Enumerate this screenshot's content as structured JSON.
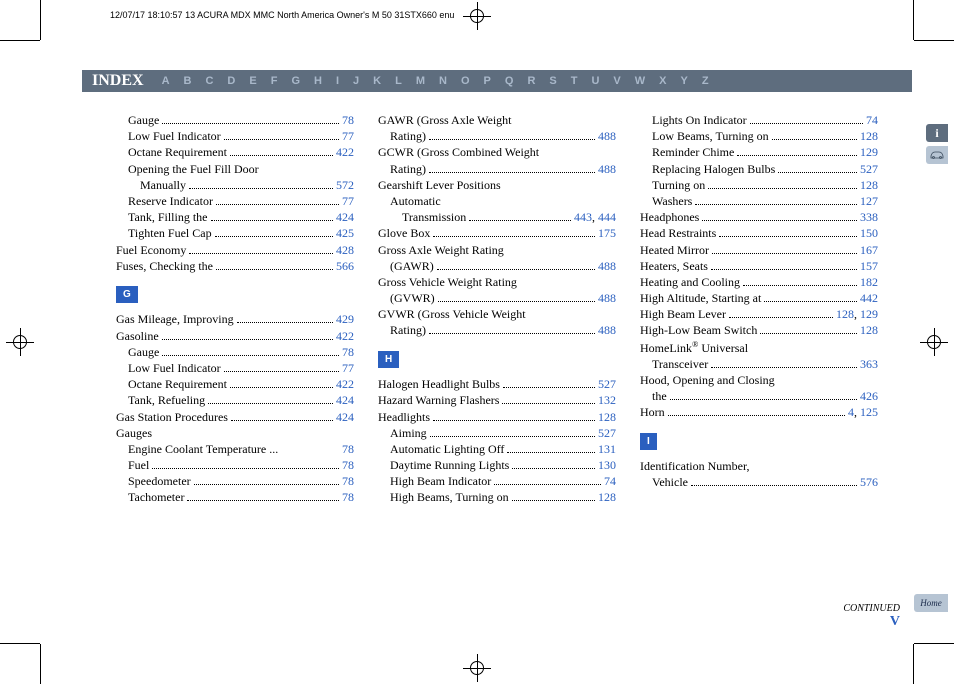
{
  "meta_header": "12/07/17 18:10:57   13 ACURA MDX MMC North America Owner's M 50 31STX660 enu",
  "index_title": "INDEX",
  "alphabet": [
    "A",
    "B",
    "C",
    "D",
    "E",
    "F",
    "G",
    "H",
    "I",
    "J",
    "K",
    "L",
    "M",
    "N",
    "O",
    "P",
    "Q",
    "R",
    "S",
    "T",
    "U",
    "V",
    "W",
    "X",
    "Y",
    "Z"
  ],
  "continued": "CONTINUED",
  "page_num": "V",
  "home": "Home",
  "col1": [
    {
      "t": "entry",
      "indent": 1,
      "label": "Gauge",
      "page": "78"
    },
    {
      "t": "entry",
      "indent": 1,
      "label": "Low Fuel Indicator",
      "page": "77"
    },
    {
      "t": "entry",
      "indent": 1,
      "label": "Octane Requirement",
      "page": "422"
    },
    {
      "t": "noref",
      "indent": 1,
      "label": "Opening the Fuel Fill Door"
    },
    {
      "t": "entry",
      "indent": 2,
      "label": "Manually",
      "page": "572"
    },
    {
      "t": "entry",
      "indent": 1,
      "label": "Reserve Indicator",
      "page": "77"
    },
    {
      "t": "entry",
      "indent": 1,
      "label": "Tank, Filling the",
      "page": "424"
    },
    {
      "t": "entry",
      "indent": 1,
      "label": "Tighten Fuel Cap",
      "page": "425"
    },
    {
      "t": "entry",
      "indent": 0,
      "label": "Fuel Economy",
      "page": "428"
    },
    {
      "t": "entry",
      "indent": 0,
      "label": "Fuses, Checking the",
      "page": "566"
    },
    {
      "t": "letter",
      "label": "G"
    },
    {
      "t": "entry",
      "indent": 0,
      "label": "Gas Mileage, Improving",
      "page": "429"
    },
    {
      "t": "entry",
      "indent": 0,
      "label": "Gasoline",
      "page": "422"
    },
    {
      "t": "entry",
      "indent": 1,
      "label": "Gauge",
      "page": "78"
    },
    {
      "t": "entry",
      "indent": 1,
      "label": "Low Fuel Indicator",
      "page": "77"
    },
    {
      "t": "entry",
      "indent": 1,
      "label": "Octane Requirement",
      "page": "422"
    },
    {
      "t": "entry",
      "indent": 1,
      "label": "Tank, Refueling",
      "page": "424"
    },
    {
      "t": "entry",
      "indent": 0,
      "label": "Gas Station Procedures",
      "page": "424"
    },
    {
      "t": "noref",
      "indent": 0,
      "label": "Gauges"
    },
    {
      "t": "entry",
      "indent": 1,
      "label": "Engine Coolant Temperature",
      "page": "78",
      "ellipsis": true
    },
    {
      "t": "entry",
      "indent": 1,
      "label": "Fuel",
      "page": "78"
    },
    {
      "t": "entry",
      "indent": 1,
      "label": "Speedometer",
      "page": "78"
    },
    {
      "t": "entry",
      "indent": 1,
      "label": "Tachometer",
      "page": "78"
    }
  ],
  "col2": [
    {
      "t": "noref",
      "indent": 0,
      "label": "GAWR (Gross Axle Weight"
    },
    {
      "t": "entry",
      "indent": 1,
      "label": "Rating)",
      "page": "488"
    },
    {
      "t": "noref",
      "indent": 0,
      "label": "GCWR (Gross Combined Weight"
    },
    {
      "t": "entry",
      "indent": 1,
      "label": "Rating)",
      "page": "488"
    },
    {
      "t": "noref",
      "indent": 0,
      "label": "Gearshift Lever Positions"
    },
    {
      "t": "noref",
      "indent": 1,
      "label": "Automatic"
    },
    {
      "t": "entry",
      "indent": 2,
      "label": "Transmission",
      "pages": [
        "443",
        "444"
      ]
    },
    {
      "t": "entry",
      "indent": 0,
      "label": "Glove Box",
      "page": "175"
    },
    {
      "t": "noref",
      "indent": 0,
      "label": "Gross Axle Weight Rating"
    },
    {
      "t": "entry",
      "indent": 1,
      "label": "(GAWR)",
      "page": "488"
    },
    {
      "t": "noref",
      "indent": 0,
      "label": "Gross Vehicle Weight Rating"
    },
    {
      "t": "entry",
      "indent": 1,
      "label": "(GVWR)",
      "page": "488"
    },
    {
      "t": "noref",
      "indent": 0,
      "label": "GVWR (Gross Vehicle Weight"
    },
    {
      "t": "entry",
      "indent": 1,
      "label": "Rating)",
      "page": "488"
    },
    {
      "t": "letter",
      "label": "H"
    },
    {
      "t": "entry",
      "indent": 0,
      "label": "Halogen Headlight Bulbs",
      "page": "527"
    },
    {
      "t": "entry",
      "indent": 0,
      "label": "Hazard Warning Flashers",
      "page": "132"
    },
    {
      "t": "entry",
      "indent": 0,
      "label": "Headlights",
      "page": "128"
    },
    {
      "t": "entry",
      "indent": 1,
      "label": "Aiming",
      "page": "527"
    },
    {
      "t": "entry",
      "indent": 1,
      "label": "Automatic Lighting Off",
      "page": "131"
    },
    {
      "t": "entry",
      "indent": 1,
      "label": "Daytime Running Lights",
      "page": "130"
    },
    {
      "t": "entry",
      "indent": 1,
      "label": "High Beam Indicator",
      "page": "74"
    },
    {
      "t": "entry",
      "indent": 1,
      "label": "High Beams, Turning on",
      "page": "128"
    }
  ],
  "col3": [
    {
      "t": "entry",
      "indent": 1,
      "label": "Lights On Indicator",
      "page": "74"
    },
    {
      "t": "entry",
      "indent": 1,
      "label": "Low Beams, Turning on",
      "page": "128"
    },
    {
      "t": "entry",
      "indent": 1,
      "label": "Reminder Chime",
      "page": "129"
    },
    {
      "t": "entry",
      "indent": 1,
      "label": "Replacing Halogen Bulbs",
      "page": "527"
    },
    {
      "t": "entry",
      "indent": 1,
      "label": "Turning on",
      "page": "128"
    },
    {
      "t": "entry",
      "indent": 1,
      "label": "Washers",
      "page": "127"
    },
    {
      "t": "entry",
      "indent": 0,
      "label": "Headphones",
      "page": "338"
    },
    {
      "t": "entry",
      "indent": 0,
      "label": "Head Restraints",
      "page": "150"
    },
    {
      "t": "entry",
      "indent": 0,
      "label": "Heated Mirror",
      "page": "167"
    },
    {
      "t": "entry",
      "indent": 0,
      "label": "Heaters, Seats",
      "page": "157"
    },
    {
      "t": "entry",
      "indent": 0,
      "label": "Heating and Cooling",
      "page": "182"
    },
    {
      "t": "entry",
      "indent": 0,
      "label": "High Altitude, Starting at",
      "page": "442"
    },
    {
      "t": "entry",
      "indent": 0,
      "label": "High Beam Lever",
      "pages": [
        "128",
        "129"
      ]
    },
    {
      "t": "entry",
      "indent": 0,
      "label": "High-Low Beam Switch",
      "page": "128"
    },
    {
      "t": "noref",
      "indent": 0,
      "label": "HomeLink® Universal",
      "html": "HomeLink<sup>®</sup> Universal"
    },
    {
      "t": "entry",
      "indent": 1,
      "label": "Transceiver",
      "page": "363"
    },
    {
      "t": "noref",
      "indent": 0,
      "label": "Hood, Opening and Closing"
    },
    {
      "t": "entry",
      "indent": 1,
      "label": "the",
      "page": "426"
    },
    {
      "t": "entry",
      "indent": 0,
      "label": "Horn",
      "pages": [
        "4",
        "125"
      ]
    },
    {
      "t": "letter",
      "label": "I"
    },
    {
      "t": "noref",
      "indent": 0,
      "label": "Identification Number,"
    },
    {
      "t": "entry",
      "indent": 1,
      "label": "Vehicle",
      "page": "576"
    }
  ]
}
